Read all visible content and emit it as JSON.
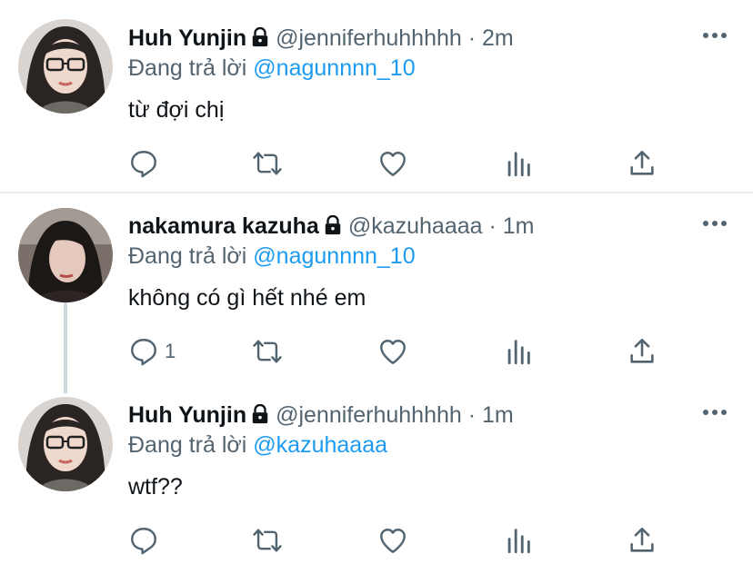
{
  "tweets": [
    {
      "name": "Huh Yunjin",
      "handle": "@jenniferhuhhhhh",
      "dot": "·",
      "time": "2m",
      "reply_prefix": "Đang trả lời",
      "reply_to": "@nagunnnn_10",
      "text": "từ đợi chị",
      "reply_count": ""
    },
    {
      "name": "nakamura kazuha",
      "handle": "@kazuhaaaa",
      "dot": "·",
      "time": "1m",
      "reply_prefix": "Đang trả lời",
      "reply_to": "@nagunnnn_10",
      "text": "không có gì hết nhé em",
      "reply_count": "1"
    },
    {
      "name": "Huh Yunjin",
      "handle": "@jenniferhuhhhhh",
      "dot": "·",
      "time": "1m",
      "reply_prefix": "Đang trả lời",
      "reply_to": "@kazuhaaaa",
      "text": "wtf??",
      "reply_count": ""
    }
  ],
  "icons": [
    "reply-icon",
    "retweet-icon",
    "like-icon",
    "analytics-icon",
    "share-icon",
    "more-icon",
    "lock-icon"
  ],
  "colors": {
    "mention": "#1d9bf0",
    "secondary_text": "#536471",
    "icon": "#536471"
  }
}
